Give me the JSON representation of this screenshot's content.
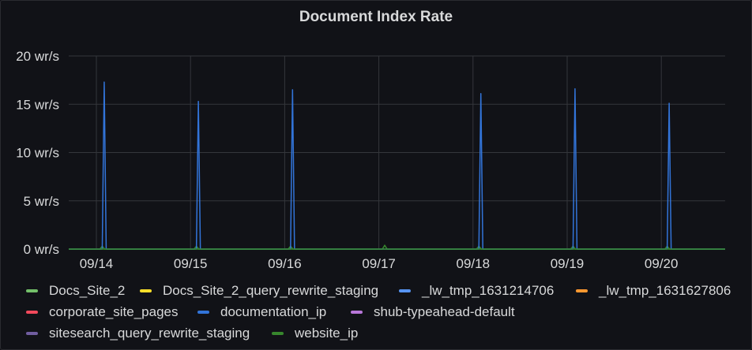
{
  "panel": {
    "title": "Document Index Rate"
  },
  "chart_data": {
    "type": "line",
    "title": "Document Index Rate",
    "xlabel": "",
    "ylabel": "",
    "ylim": [
      0,
      20
    ],
    "y_unit": "wr/s",
    "y_ticks": [
      "0 wr/s",
      "5 wr/s",
      "10 wr/s",
      "15 wr/s",
      "20 wr/s"
    ],
    "x_ticks": [
      "09/14",
      "09/15",
      "09/16",
      "09/17",
      "09/18",
      "09/19",
      "09/20"
    ],
    "grid": true,
    "legend_position": "bottom",
    "series": [
      {
        "name": "Docs_Site_2",
        "color": "#73bf69",
        "points": [
          [
            "09/14",
            0
          ],
          [
            "09/20",
            0
          ]
        ]
      },
      {
        "name": "Docs_Site_2_query_rewrite_staging",
        "color": "#fade2a",
        "points": [
          [
            "09/14",
            0
          ],
          [
            "09/20",
            0
          ]
        ]
      },
      {
        "name": "_lw_tmp_1631214706",
        "color": "#5794f2",
        "points": [
          [
            "09/14",
            0
          ],
          [
            "09/20",
            0
          ]
        ]
      },
      {
        "name": "_lw_tmp_1631627806",
        "color": "#ff9830",
        "points": [
          [
            "09/14",
            0
          ],
          [
            "09/20",
            0
          ]
        ]
      },
      {
        "name": "corporate_site_pages",
        "color": "#f2495c",
        "points": [
          [
            "09/14",
            0
          ],
          [
            "09/20",
            0
          ]
        ]
      },
      {
        "name": "documentation_ip",
        "color": "#3274d9",
        "points": [
          [
            "09/14 02:00",
            17.3
          ],
          [
            "09/15 02:00",
            15.3
          ],
          [
            "09/16 02:00",
            16.5
          ],
          [
            "09/18 02:00",
            16.1
          ],
          [
            "09/19 02:00",
            16.6
          ],
          [
            "09/20 02:00",
            15.1
          ]
        ]
      },
      {
        "name": "shub-typeahead-default",
        "color": "#b877d9",
        "points": [
          [
            "09/14",
            0
          ],
          [
            "09/20",
            0
          ]
        ]
      },
      {
        "name": "sitesearch_query_rewrite_staging",
        "color": "#705da0",
        "points": [
          [
            "09/14",
            0
          ],
          [
            "09/20",
            0
          ]
        ]
      },
      {
        "name": "website_ip",
        "color": "#37872d",
        "points": [
          [
            "09/14 01:30",
            0.3
          ],
          [
            "09/15 01:30",
            0.3
          ],
          [
            "09/16 01:30",
            0.3
          ],
          [
            "09/17 01:30",
            0.4
          ],
          [
            "09/18 01:30",
            0.3
          ],
          [
            "09/19 01:30",
            0.3
          ],
          [
            "09/20 01:30",
            0.3
          ]
        ]
      }
    ]
  },
  "legend": [
    {
      "label": "Docs_Site_2",
      "color": "#73bf69"
    },
    {
      "label": "Docs_Site_2_query_rewrite_staging",
      "color": "#fade2a"
    },
    {
      "label": "_lw_tmp_1631214706",
      "color": "#5794f2"
    },
    {
      "label": "_lw_tmp_1631627806",
      "color": "#ff9830"
    },
    {
      "label": "corporate_site_pages",
      "color": "#f2495c"
    },
    {
      "label": "documentation_ip",
      "color": "#3274d9"
    },
    {
      "label": "shub-typeahead-default",
      "color": "#b877d9"
    },
    {
      "label": "sitesearch_query_rewrite_staging",
      "color": "#705da0"
    },
    {
      "label": "website_ip",
      "color": "#37872d"
    }
  ]
}
